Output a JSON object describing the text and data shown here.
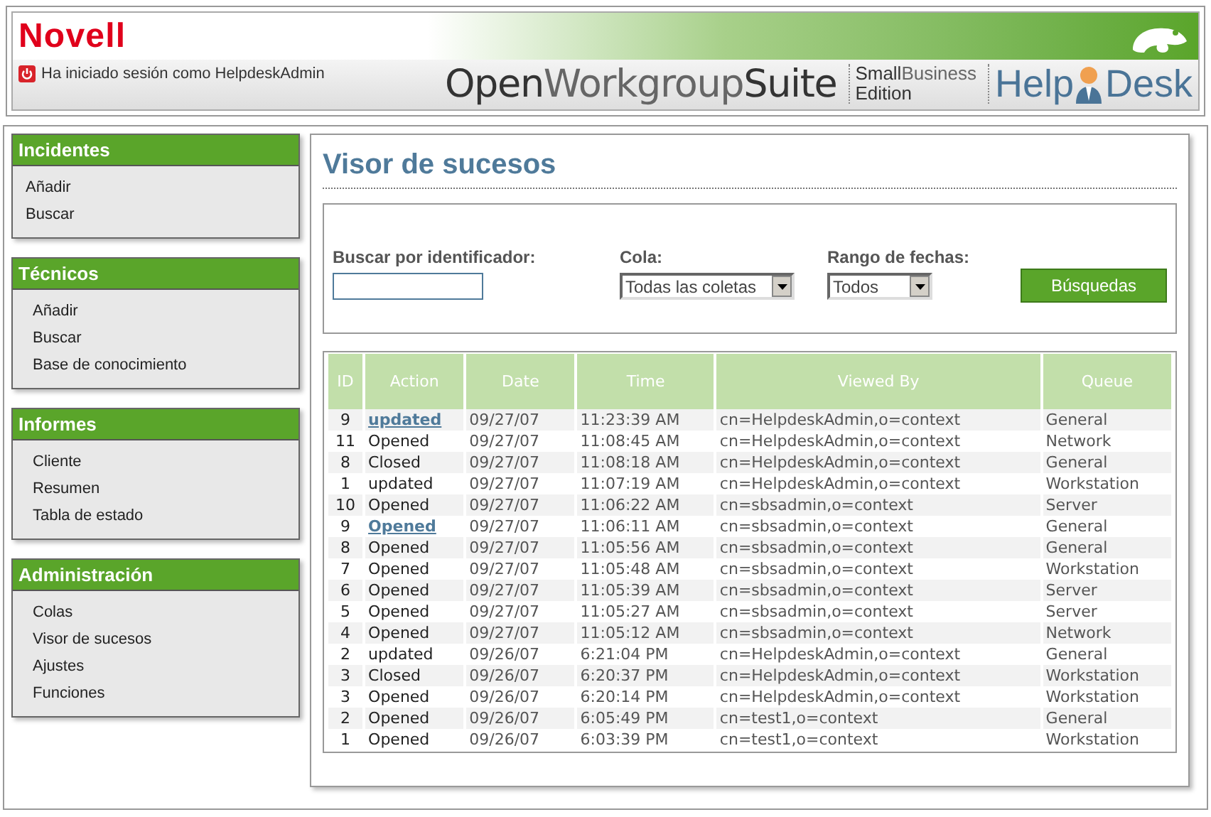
{
  "header": {
    "brand": "Novell",
    "login": "Ha iniciado sesión como HelpdeskAdmin",
    "suite_a": "Open",
    "suite_b": "Workgroup",
    "suite_c": "Suite",
    "edition_a": "Small",
    "edition_b": "Business",
    "edition_c": "Edition",
    "help_a": "Help",
    "help_b": "Desk"
  },
  "sidebar": [
    {
      "title": "Incidentes",
      "items": [
        "Añadir",
        "Buscar"
      ]
    },
    {
      "title": "Técnicos",
      "items": [
        "Añadir",
        "Buscar",
        "Base de conocimiento"
      ]
    },
    {
      "title": "Informes",
      "items": [
        "Cliente",
        "Resumen",
        "Tabla de estado"
      ]
    },
    {
      "title": "Administración",
      "items": [
        "Colas",
        "Visor de sucesos",
        "Ajustes",
        "Funciones"
      ]
    }
  ],
  "page_title": "Visor de sucesos",
  "search": {
    "id_label": "Buscar por identificador:",
    "queue_label": "Cola:",
    "queue_value": "Todas las coletas",
    "range_label": "Rango de fechas:",
    "range_value": "Todos",
    "button": "Búsquedas"
  },
  "table": {
    "columns": [
      "ID",
      "Action",
      "Date",
      "Time",
      "Viewed By",
      "Queue"
    ],
    "rows": [
      {
        "cells": [
          "9",
          "updated",
          "09/27/07",
          "11:23:39 AM",
          "cn=HelpdeskAdmin,o=context",
          "General"
        ],
        "link": true
      },
      {
        "cells": [
          "11",
          "Opened",
          "09/27/07",
          "11:08:45 AM",
          "cn=HelpdeskAdmin,o=context",
          "Network"
        ],
        "link": false
      },
      {
        "cells": [
          "8",
          "Closed",
          "09/27/07",
          "11:08:18 AM",
          "cn=HelpdeskAdmin,o=context",
          "General"
        ],
        "link": false
      },
      {
        "cells": [
          "1",
          "updated",
          "09/27/07",
          "11:07:19 AM",
          "cn=HelpdeskAdmin,o=context",
          "Workstation"
        ],
        "link": false
      },
      {
        "cells": [
          "10",
          "Opened",
          "09/27/07",
          "11:06:22 AM",
          "cn=sbsadmin,o=context",
          "Server"
        ],
        "link": false
      },
      {
        "cells": [
          "9",
          "Opened",
          "09/27/07",
          "11:06:11 AM",
          "cn=sbsadmin,o=context",
          "General"
        ],
        "link": true
      },
      {
        "cells": [
          "8",
          "Opened",
          "09/27/07",
          "11:05:56 AM",
          "cn=sbsadmin,o=context",
          "General"
        ],
        "link": false
      },
      {
        "cells": [
          "7",
          "Opened",
          "09/27/07",
          "11:05:48 AM",
          "cn=sbsadmin,o=context",
          "Workstation"
        ],
        "link": false
      },
      {
        "cells": [
          "6",
          "Opened",
          "09/27/07",
          "11:05:39 AM",
          "cn=sbsadmin,o=context",
          "Server"
        ],
        "link": false
      },
      {
        "cells": [
          "5",
          "Opened",
          "09/27/07",
          "11:05:27 AM",
          "cn=sbsadmin,o=context",
          "Server"
        ],
        "link": false
      },
      {
        "cells": [
          "4",
          "Opened",
          "09/27/07",
          "11:05:12 AM",
          "cn=sbsadmin,o=context",
          "Network"
        ],
        "link": false
      },
      {
        "cells": [
          "2",
          "updated",
          "09/26/07",
          "6:21:04 PM",
          "cn=HelpdeskAdmin,o=context",
          "General"
        ],
        "link": false
      },
      {
        "cells": [
          "3",
          "Closed",
          "09/26/07",
          "6:20:37 PM",
          "cn=HelpdeskAdmin,o=context",
          "Workstation"
        ],
        "link": false
      },
      {
        "cells": [
          "3",
          "Opened",
          "09/26/07",
          "6:20:14 PM",
          "cn=HelpdeskAdmin,o=context",
          "Workstation"
        ],
        "link": false
      },
      {
        "cells": [
          "2",
          "Opened",
          "09/26/07",
          "6:05:49 PM",
          "cn=test1,o=context",
          "General"
        ],
        "link": false
      },
      {
        "cells": [
          "1",
          "Opened",
          "09/26/07",
          "6:03:39 PM",
          "cn=test1,o=context",
          "Workstation"
        ],
        "link": false
      }
    ]
  }
}
